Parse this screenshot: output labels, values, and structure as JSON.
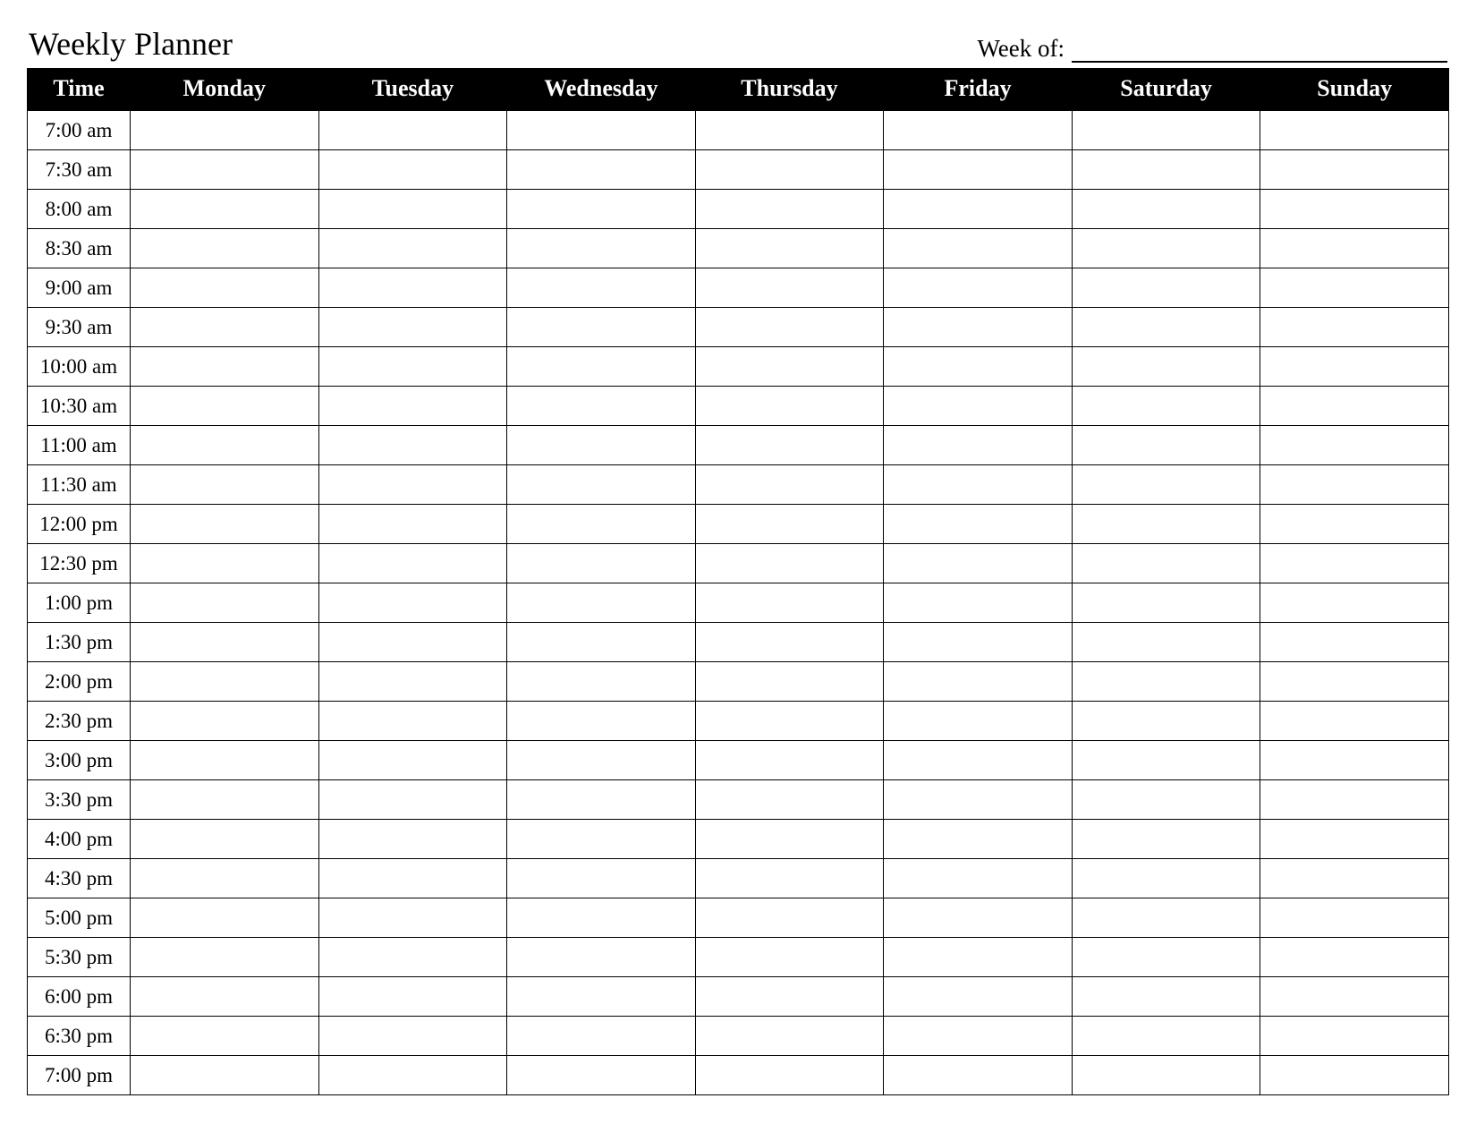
{
  "header": {
    "title": "Weekly Planner",
    "week_of_label": "Week of:",
    "week_of_value": ""
  },
  "columns": [
    "Time",
    "Monday",
    "Tuesday",
    "Wednesday",
    "Thursday",
    "Friday",
    "Saturday",
    "Sunday"
  ],
  "rows": [
    {
      "time": "7:00 am",
      "cells": [
        "",
        "",
        "",
        "",
        "",
        "",
        ""
      ]
    },
    {
      "time": "7:30 am",
      "cells": [
        "",
        "",
        "",
        "",
        "",
        "",
        ""
      ]
    },
    {
      "time": "8:00 am",
      "cells": [
        "",
        "",
        "",
        "",
        "",
        "",
        ""
      ]
    },
    {
      "time": "8:30 am",
      "cells": [
        "",
        "",
        "",
        "",
        "",
        "",
        ""
      ]
    },
    {
      "time": "9:00 am",
      "cells": [
        "",
        "",
        "",
        "",
        "",
        "",
        ""
      ]
    },
    {
      "time": "9:30 am",
      "cells": [
        "",
        "",
        "",
        "",
        "",
        "",
        ""
      ]
    },
    {
      "time": "10:00 am",
      "cells": [
        "",
        "",
        "",
        "",
        "",
        "",
        ""
      ]
    },
    {
      "time": "10:30 am",
      "cells": [
        "",
        "",
        "",
        "",
        "",
        "",
        ""
      ]
    },
    {
      "time": "11:00 am",
      "cells": [
        "",
        "",
        "",
        "",
        "",
        "",
        ""
      ]
    },
    {
      "time": "11:30 am",
      "cells": [
        "",
        "",
        "",
        "",
        "",
        "",
        ""
      ]
    },
    {
      "time": "12:00 pm",
      "cells": [
        "",
        "",
        "",
        "",
        "",
        "",
        ""
      ]
    },
    {
      "time": "12:30 pm",
      "cells": [
        "",
        "",
        "",
        "",
        "",
        "",
        ""
      ]
    },
    {
      "time": "1:00 pm",
      "cells": [
        "",
        "",
        "",
        "",
        "",
        "",
        ""
      ]
    },
    {
      "time": "1:30 pm",
      "cells": [
        "",
        "",
        "",
        "",
        "",
        "",
        ""
      ]
    },
    {
      "time": "2:00 pm",
      "cells": [
        "",
        "",
        "",
        "",
        "",
        "",
        ""
      ]
    },
    {
      "time": "2:30 pm",
      "cells": [
        "",
        "",
        "",
        "",
        "",
        "",
        ""
      ]
    },
    {
      "time": "3:00 pm",
      "cells": [
        "",
        "",
        "",
        "",
        "",
        "",
        ""
      ]
    },
    {
      "time": "3:30 pm",
      "cells": [
        "",
        "",
        "",
        "",
        "",
        "",
        ""
      ]
    },
    {
      "time": "4:00 pm",
      "cells": [
        "",
        "",
        "",
        "",
        "",
        "",
        ""
      ]
    },
    {
      "time": "4:30 pm",
      "cells": [
        "",
        "",
        "",
        "",
        "",
        "",
        ""
      ]
    },
    {
      "time": "5:00 pm",
      "cells": [
        "",
        "",
        "",
        "",
        "",
        "",
        ""
      ]
    },
    {
      "time": "5:30 pm",
      "cells": [
        "",
        "",
        "",
        "",
        "",
        "",
        ""
      ]
    },
    {
      "time": "6:00 pm",
      "cells": [
        "",
        "",
        "",
        "",
        "",
        "",
        ""
      ]
    },
    {
      "time": "6:30 pm",
      "cells": [
        "",
        "",
        "",
        "",
        "",
        "",
        ""
      ]
    },
    {
      "time": "7:00 pm",
      "cells": [
        "",
        "",
        "",
        "",
        "",
        "",
        ""
      ]
    }
  ]
}
